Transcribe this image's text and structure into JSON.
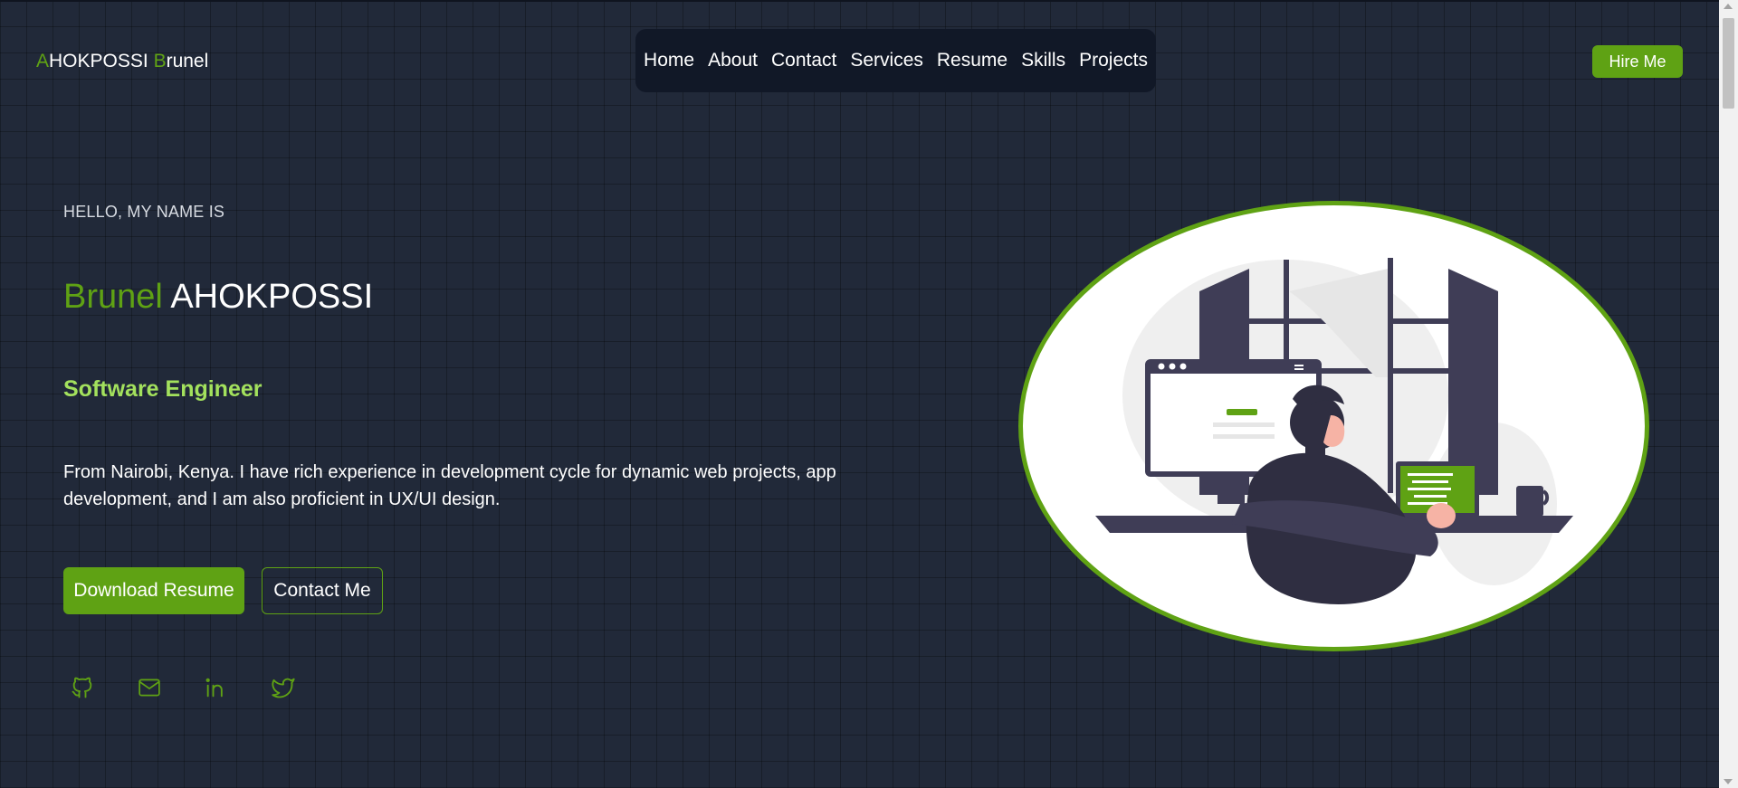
{
  "brand": {
    "first_letter": "A",
    "surname_rest": "HOKPOSSI",
    "second_letter": "B",
    "firstname_rest": "runel"
  },
  "nav": {
    "items": [
      {
        "label": "Home"
      },
      {
        "label": "About"
      },
      {
        "label": "Contact"
      },
      {
        "label": "Services"
      },
      {
        "label": "Resume"
      },
      {
        "label": "Skills"
      },
      {
        "label": "Projects"
      }
    ]
  },
  "header": {
    "hire_label": "Hire Me"
  },
  "hero": {
    "greeting": "HELLO, MY NAME IS",
    "first_name": "Brunel",
    "last_name": "AHOKPOSSI",
    "role": "Software Engineer",
    "description": "From Nairobi, Kenya. I have rich experience in development cycle for dynamic web projects, app development, and I am also proficient in UX/UI design.",
    "download_label": "Download Resume",
    "contact_label": "Contact Me"
  },
  "socials": [
    {
      "icon": "github-icon"
    },
    {
      "icon": "mail-icon"
    },
    {
      "icon": "linkedin-icon"
    },
    {
      "icon": "twitter-icon"
    }
  ],
  "colors": {
    "background": "#212939",
    "accent": "#5fa214",
    "role": "#a3e15d",
    "nav_bg": "#111827"
  }
}
